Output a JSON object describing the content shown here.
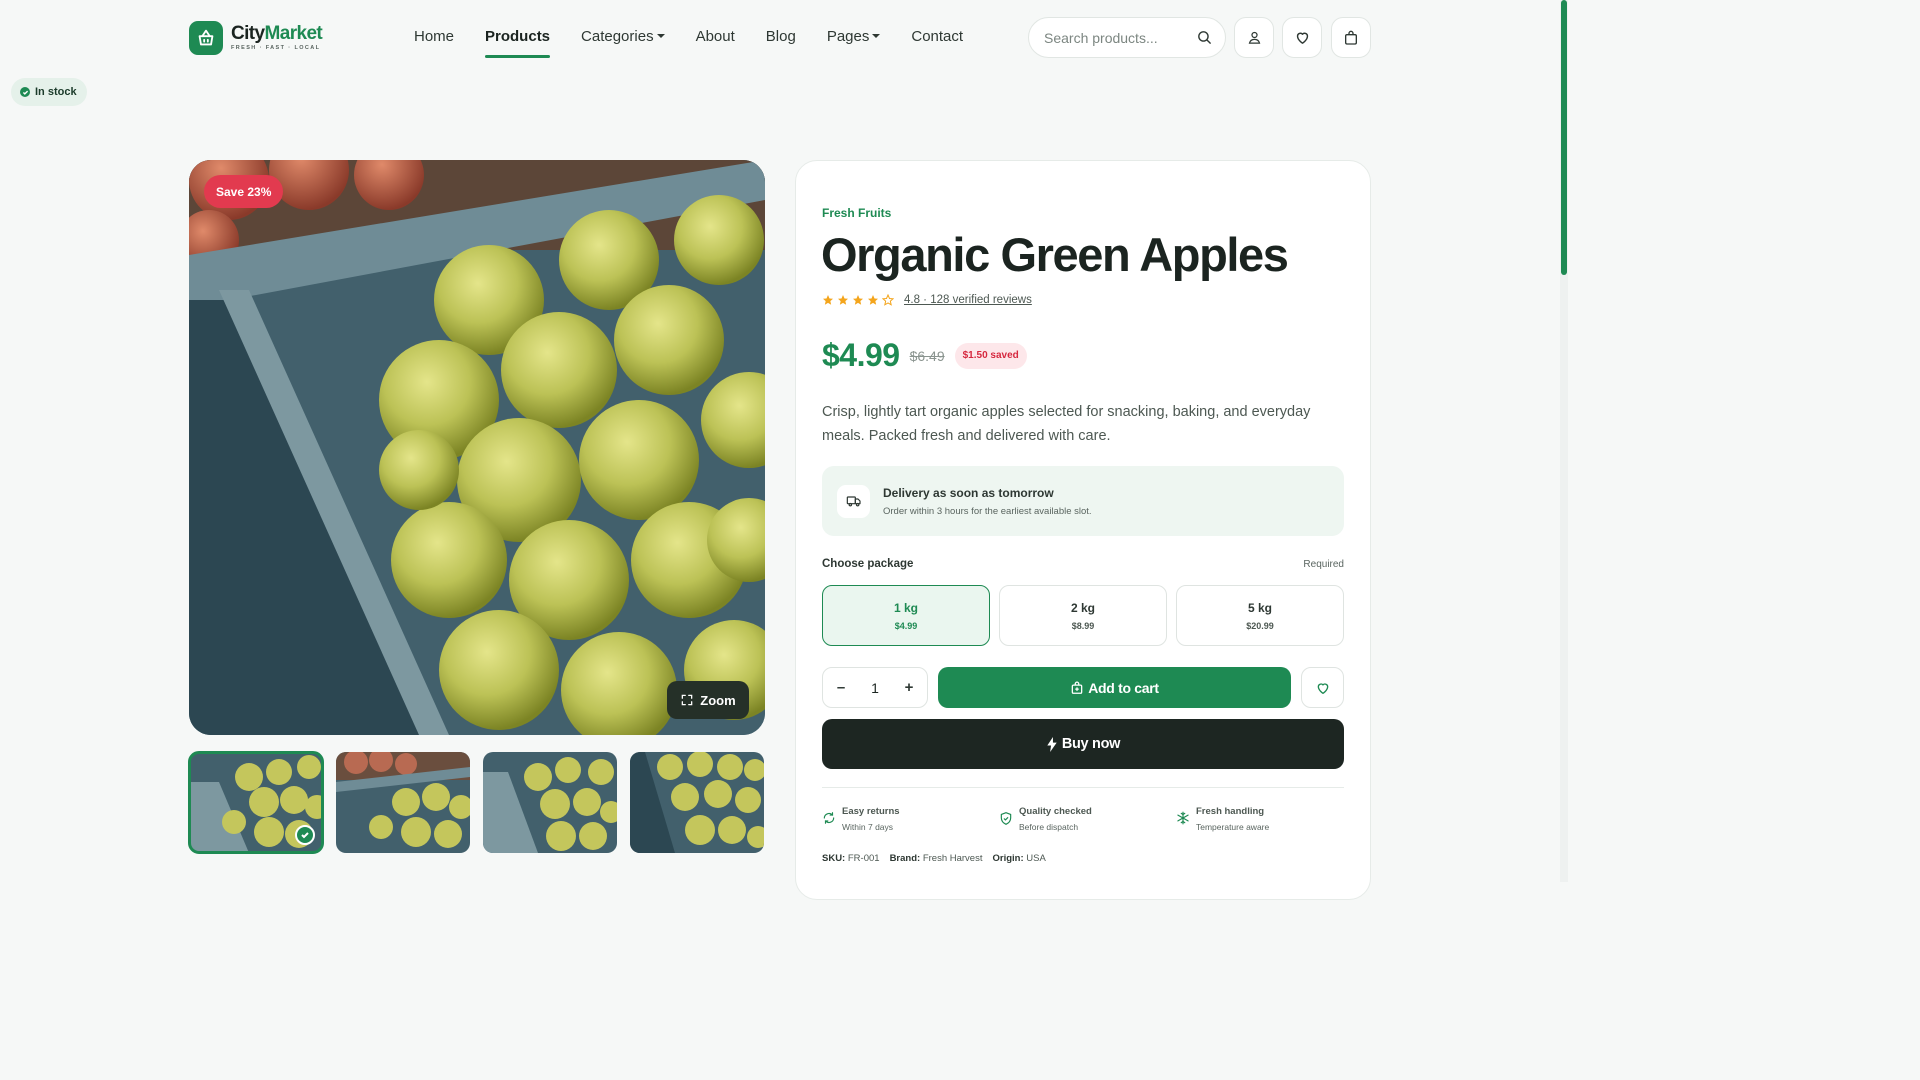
{
  "header": {
    "logo": {
      "name_part1": "City",
      "name_part2": "Market",
      "tagline": "FRESH · FAST · LOCAL"
    },
    "nav": [
      {
        "label": "Home"
      },
      {
        "label": "Products",
        "active": true
      },
      {
        "label": "Categories",
        "dropdown": true
      },
      {
        "label": "About"
      },
      {
        "label": "Blog"
      },
      {
        "label": "Pages",
        "dropdown": true
      },
      {
        "label": "Contact"
      }
    ],
    "search": {
      "placeholder": "Search products...",
      "value": ""
    },
    "icons": [
      "user-icon",
      "heart-icon",
      "shopping-bag-icon"
    ]
  },
  "stock_status": "In stock",
  "gallery": {
    "save_badge": "Save 23%",
    "zoom_label": "Zoom",
    "thumbnails": [
      {
        "selected": true
      },
      {
        "selected": false
      },
      {
        "selected": false
      },
      {
        "selected": false
      }
    ]
  },
  "product": {
    "category": "Fresh Fruits",
    "title": "Organic Green Apples",
    "rating": 4.8,
    "rating_text": "4.8 · 128 verified reviews",
    "price": "$4.99",
    "old_price": "$6.49",
    "saved": "$1.50 saved",
    "description": "Crisp, lightly tart organic apples selected for snacking, baking, and everyday meals. Packed fresh and delivered with care.",
    "delivery": {
      "title": "Delivery as soon as tomorrow",
      "subtitle": "Order within 3 hours for the earliest available slot."
    },
    "package_label": "Choose package",
    "package_required": "Required",
    "packages": [
      {
        "name": "1 kg",
        "price": "$4.99",
        "selected": true
      },
      {
        "name": "2 kg",
        "price": "$8.99",
        "selected": false
      },
      {
        "name": "5 kg",
        "price": "$20.99",
        "selected": false
      }
    ],
    "quantity": {
      "minus": "–",
      "value": "1",
      "plus": "+"
    },
    "add_to_cart": "Add to cart",
    "buy_now": "Buy now",
    "features": [
      {
        "icon": "refresh-icon",
        "title": "Easy returns",
        "subtitle": "Within 7 days"
      },
      {
        "icon": "shield-check-icon",
        "title": "Quality checked",
        "subtitle": "Before dispatch"
      },
      {
        "icon": "snowflake-icon",
        "title": "Fresh handling",
        "subtitle": "Temperature aware"
      }
    ],
    "meta": {
      "sku_label": "SKU:",
      "sku": "FR-001",
      "brand_label": "Brand:",
      "brand": "Fresh Harvest",
      "origin_label": "Origin:",
      "origin": "USA"
    }
  },
  "colors": {
    "brand_green": "#1e8a53",
    "dark": "#1d2622",
    "sale_red": "#e23a4f",
    "star": "#f4a51c"
  }
}
